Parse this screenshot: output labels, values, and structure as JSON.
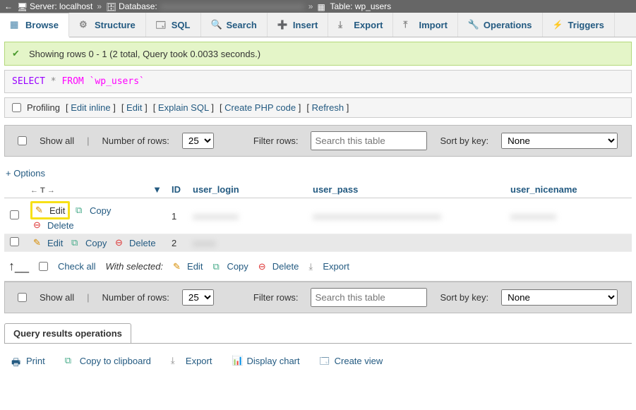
{
  "breadcrumb": {
    "back_icon": "←",
    "server_label": "Server: localhost",
    "database_label": "Database:",
    "table_label": "Table: wp_users"
  },
  "tabs": {
    "browse": "Browse",
    "structure": "Structure",
    "sql": "SQL",
    "search": "Search",
    "insert": "Insert",
    "export": "Export",
    "import": "Import",
    "operations": "Operations",
    "triggers": "Triggers"
  },
  "msg": {
    "text": "Showing rows 0 - 1 (2 total, Query took 0.0033 seconds.)"
  },
  "sql": {
    "select": "SELECT",
    "star": "*",
    "from": "FROM",
    "table": "`wp_users`"
  },
  "sqlactions": {
    "profiling": "Profiling",
    "edit_inline": "Edit inline",
    "edit": "Edit",
    "explain": "Explain SQL",
    "create_php": "Create PHP code",
    "refresh": "Refresh"
  },
  "controls": {
    "show_all": "Show all",
    "num_rows_label": "Number of rows:",
    "num_rows_value": "25",
    "filter_label": "Filter rows:",
    "filter_placeholder": "Search this table",
    "sort_label": "Sort by key:",
    "sort_value": "None"
  },
  "options_link": "+ Options",
  "columns": {
    "id": "ID",
    "user_login": "user_login",
    "user_pass": "user_pass",
    "user_nicename": "user_nicename"
  },
  "row_actions": {
    "edit": "Edit",
    "copy": "Copy",
    "delete": "Delete"
  },
  "rows": [
    {
      "id": "1"
    },
    {
      "id": "2"
    }
  ],
  "bulk": {
    "check_all": "Check all",
    "with_selected": "With selected:",
    "edit": "Edit",
    "copy": "Copy",
    "delete": "Delete",
    "export": "Export"
  },
  "panel": {
    "title": "Query results operations",
    "print": "Print",
    "copy_clip": "Copy to clipboard",
    "export": "Export",
    "chart": "Display chart",
    "create_view": "Create view"
  }
}
